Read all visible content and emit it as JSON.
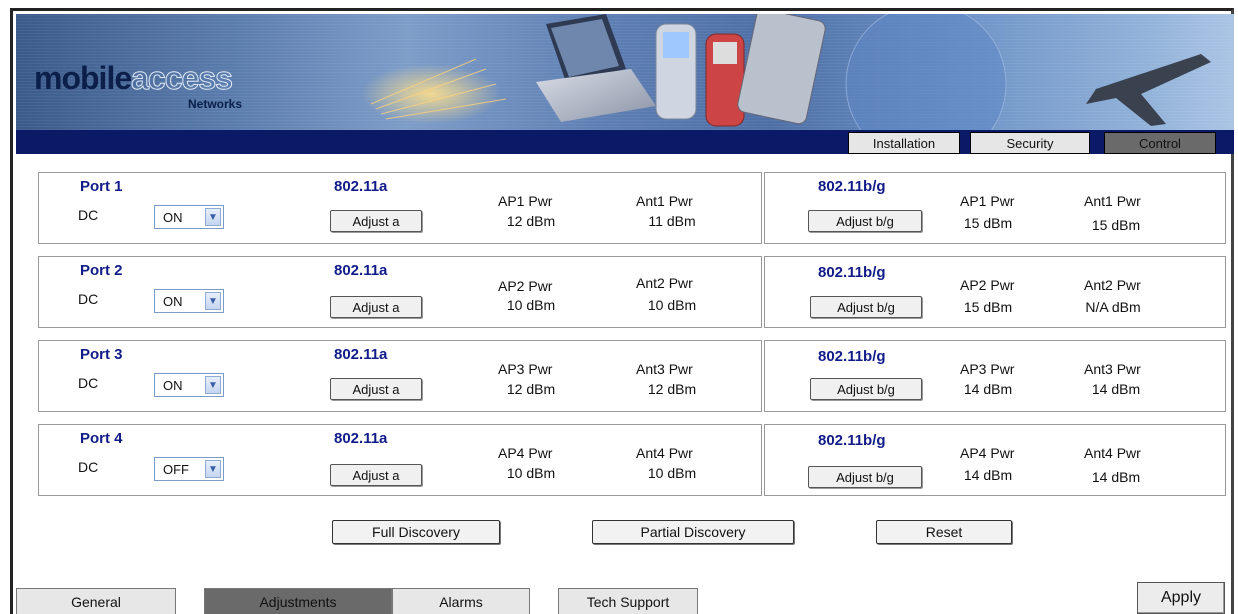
{
  "brand": {
    "logo_main": "mobile",
    "logo_accent": "access",
    "logo_sub": "Networks"
  },
  "top_nav": {
    "items": [
      {
        "label": "Installation",
        "active": false
      },
      {
        "label": "Security",
        "active": false
      },
      {
        "label": "Control",
        "active": true
      }
    ]
  },
  "ports": [
    {
      "title": "Port 1",
      "dc_label": "DC",
      "dc_value": "ON",
      "a": {
        "std": "802.11a",
        "adjust": "Adjust a",
        "ap_label": "AP1 Pwr",
        "ap_value": "12 dBm",
        "ant_label": "Ant1 Pwr",
        "ant_value": "11 dBm"
      },
      "bg": {
        "std": "802.11b/g",
        "adjust": "Adjust b/g",
        "ap_label": "AP1 Pwr",
        "ap_value": "15 dBm",
        "ant_label": "Ant1 Pwr",
        "ant_value": "15 dBm"
      }
    },
    {
      "title": "Port 2",
      "dc_label": "DC",
      "dc_value": "ON",
      "a": {
        "std": "802.11a",
        "adjust": "Adjust a",
        "ap_label": "AP2 Pwr",
        "ap_value": "10 dBm",
        "ant_label": "Ant2 Pwr",
        "ant_value": "10 dBm"
      },
      "bg": {
        "std": "802.11b/g",
        "adjust": "Adjust b/g",
        "ap_label": "AP2 Pwr",
        "ap_value": "15 dBm",
        "ant_label": "Ant2 Pwr",
        "ant_value": "N/A dBm"
      }
    },
    {
      "title": "Port 3",
      "dc_label": "DC",
      "dc_value": "ON",
      "a": {
        "std": "802.11a",
        "adjust": "Adjust a",
        "ap_label": "AP3 Pwr",
        "ap_value": "12 dBm",
        "ant_label": "Ant3 Pwr",
        "ant_value": "12 dBm"
      },
      "bg": {
        "std": "802.11b/g",
        "adjust": "Adjust b/g",
        "ap_label": "AP3 Pwr",
        "ap_value": "14 dBm",
        "ant_label": "Ant3 Pwr",
        "ant_value": "14 dBm"
      }
    },
    {
      "title": "Port 4",
      "dc_label": "DC",
      "dc_value": "OFF",
      "a": {
        "std": "802.11a",
        "adjust": "Adjust a",
        "ap_label": "AP4 Pwr",
        "ap_value": "10 dBm",
        "ant_label": "Ant4 Pwr",
        "ant_value": "10 dBm"
      },
      "bg": {
        "std": "802.11b/g",
        "adjust": "Adjust b/g",
        "ap_label": "AP4 Pwr",
        "ap_value": "14 dBm",
        "ant_label": "Ant4 Pwr",
        "ant_value": "14 dBm"
      }
    }
  ],
  "actions": {
    "full_discovery": "Full Discovery",
    "partial_discovery": "Partial Discovery",
    "reset": "Reset"
  },
  "bottom_tabs": [
    {
      "label": "General",
      "active": false
    },
    {
      "label": "Adjustments",
      "active": true
    },
    {
      "label": "Alarms",
      "active": false
    },
    {
      "label": "Tech Support",
      "active": false
    }
  ],
  "apply_label": "Apply",
  "colors": {
    "navbar": "#0a1a66",
    "heading": "#111c8a",
    "active_tab": "#6a6a6a"
  }
}
